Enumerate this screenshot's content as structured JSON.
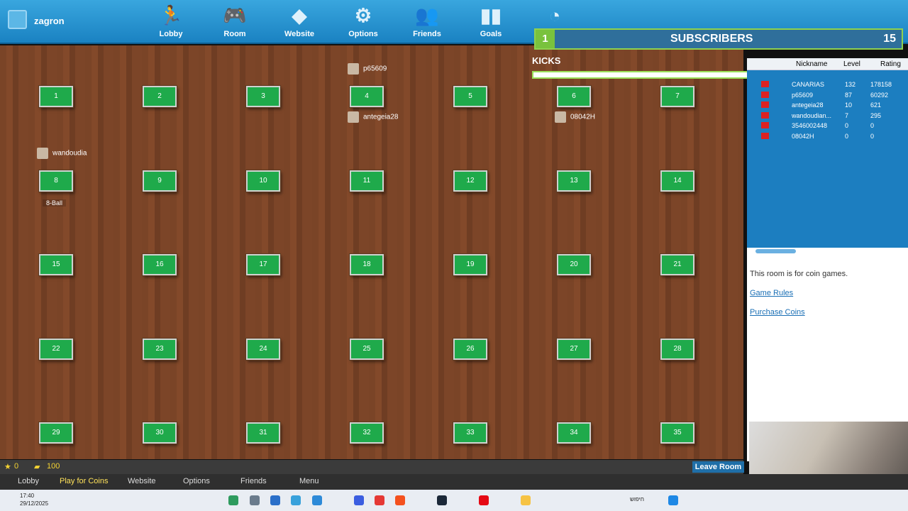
{
  "header": {
    "username": "zagron",
    "nav": [
      {
        "label": "Lobby",
        "icon": "runner-icon"
      },
      {
        "label": "Room",
        "icon": "gamepad-icon"
      },
      {
        "label": "Website",
        "icon": "website-icon"
      },
      {
        "label": "Options",
        "icon": "gear-icon"
      },
      {
        "label": "Friends",
        "icon": "friends-icon"
      },
      {
        "label": "Goals",
        "icon": "goals-icon"
      },
      {
        "label": "",
        "icon": "clock-icon"
      }
    ]
  },
  "overlay": {
    "rank": "1",
    "subscribers_label": "SUBSCRIBERS",
    "subscribers_count": "15",
    "kicks_label": "KICKS"
  },
  "tables": [
    "1",
    "2",
    "3",
    "4",
    "5",
    "6",
    "7",
    "8",
    "9",
    "10",
    "11",
    "12",
    "13",
    "14",
    "15",
    "16",
    "17",
    "18",
    "19",
    "20",
    "21",
    "22",
    "23",
    "24",
    "25",
    "26",
    "27",
    "28",
    "29",
    "30",
    "31",
    "32",
    "33",
    "34",
    "35"
  ],
  "room_players": [
    {
      "name": "p65609"
    },
    {
      "name": "antegeia28"
    },
    {
      "name": "08042H"
    },
    {
      "name": "wandoudia"
    }
  ],
  "table8_tag": "8-Ball",
  "player_list": {
    "headers": [
      "Nickname",
      "Level",
      "Rating"
    ],
    "rows": [
      {
        "nick": "CANARIAS",
        "level": "132",
        "rating": "178158"
      },
      {
        "nick": "p65609",
        "level": "87",
        "rating": "60292"
      },
      {
        "nick": "antegeia28",
        "level": "10",
        "rating": "621"
      },
      {
        "nick": "wandoudian...",
        "level": "7",
        "rating": "295"
      },
      {
        "nick": "3546002448",
        "level": "0",
        "rating": "0"
      },
      {
        "nick": "08042H",
        "level": "0",
        "rating": "0"
      }
    ]
  },
  "room_info": {
    "text": "This room is for coin games.",
    "rules": "Game Rules",
    "purchase": "Purchase Coins"
  },
  "status": {
    "stars": "0",
    "coins": "100",
    "leave": "Leave Room"
  },
  "bottom_menu": [
    "Lobby",
    "Play for Coins",
    "Website",
    "Options",
    "Friends",
    "Menu"
  ],
  "taskbar": {
    "time": "17:40",
    "date": "29/12/2025",
    "search": "חיפוש"
  },
  "colors": {
    "brand": "#1f8ccc",
    "felt": "#1faa4b",
    "accent": "#79c23d"
  }
}
